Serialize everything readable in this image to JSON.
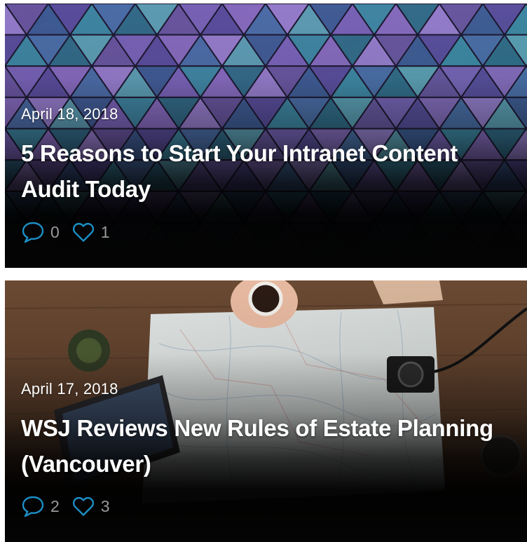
{
  "posts": [
    {
      "date": "April 18, 2018",
      "title": "5 Reasons to Start Your Intranet Content Audit Today",
      "comments": "0",
      "likes": "1",
      "image_icon": "geometric-glass-ceiling-photo"
    },
    {
      "date": "April 17, 2018",
      "title": "WSJ Reviews New Rules of Estate Planning (Vancouver)",
      "comments": "2",
      "likes": "3",
      "image_icon": "map-on-wooden-table-photo"
    }
  ],
  "icons": {
    "comment": "speech-bubble-icon",
    "like": "heart-icon"
  },
  "colors": {
    "icon_accent": "#1c8fc4",
    "count_text": "#9a9a9a",
    "title_text": "#ffffff",
    "card_background": "#050505"
  }
}
